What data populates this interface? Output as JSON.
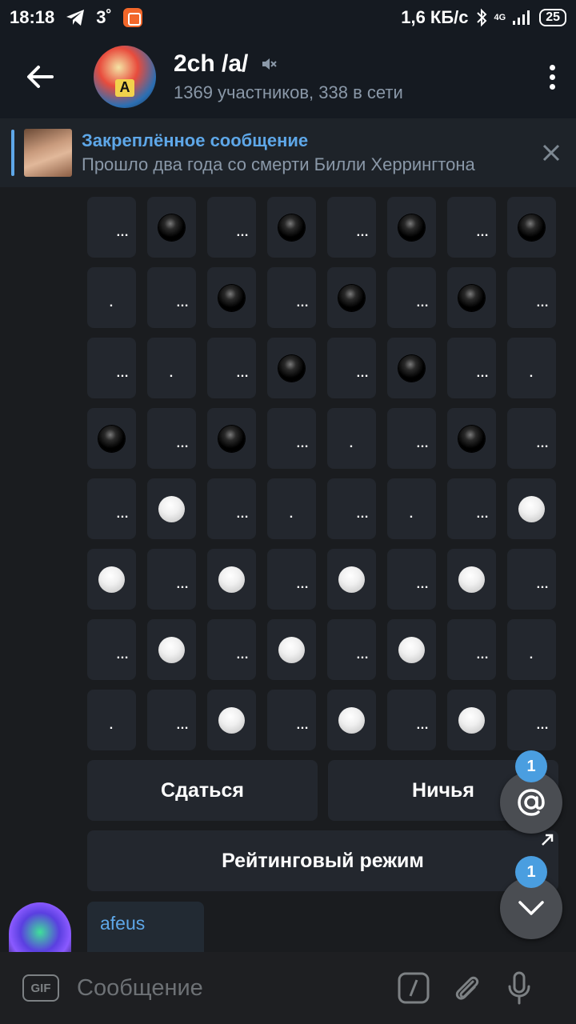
{
  "status_bar": {
    "time": "18:18",
    "temperature": "3˚",
    "net_speed": "1,6 КБ/с",
    "network_type": "4G",
    "battery": "25"
  },
  "header": {
    "title": "2ch /a/",
    "subtitle": "1369 участников, 338 в сети",
    "muted": true
  },
  "pinned": {
    "title": "Закреплённое сообщение",
    "text": "Прошло два года со смерти Билли Херрингтона"
  },
  "board": {
    "rows": [
      [
        "…",
        "black",
        "…",
        "black",
        "…",
        "black",
        "…",
        "black"
      ],
      [
        ".",
        "…",
        "black",
        "…",
        "black",
        "…",
        "black",
        "…"
      ],
      [
        "…",
        ".",
        "…",
        "black",
        "…",
        "black",
        "…",
        "."
      ],
      [
        "black",
        "…",
        "black",
        "…",
        ".",
        "…",
        "black",
        "…"
      ],
      [
        "…",
        "white",
        "…",
        ".",
        "…",
        ".",
        "…",
        "white"
      ],
      [
        "white",
        "…",
        "white",
        "…",
        "white",
        "…",
        "white",
        "…"
      ],
      [
        "…",
        "white",
        "…",
        "white",
        "…",
        "white",
        "…",
        "."
      ],
      [
        ".",
        "…",
        "white",
        "…",
        "white",
        "…",
        "white",
        "…"
      ]
    ]
  },
  "buttons": {
    "surrender": "Сдаться",
    "draw": "Ничья",
    "rating_mode": "Рейтинговый режим"
  },
  "fab": {
    "mention_badge": "1",
    "scroll_badge": "1"
  },
  "message": {
    "author": "afeus"
  },
  "input": {
    "gif_label": "GIF",
    "placeholder": "Сообщение"
  }
}
